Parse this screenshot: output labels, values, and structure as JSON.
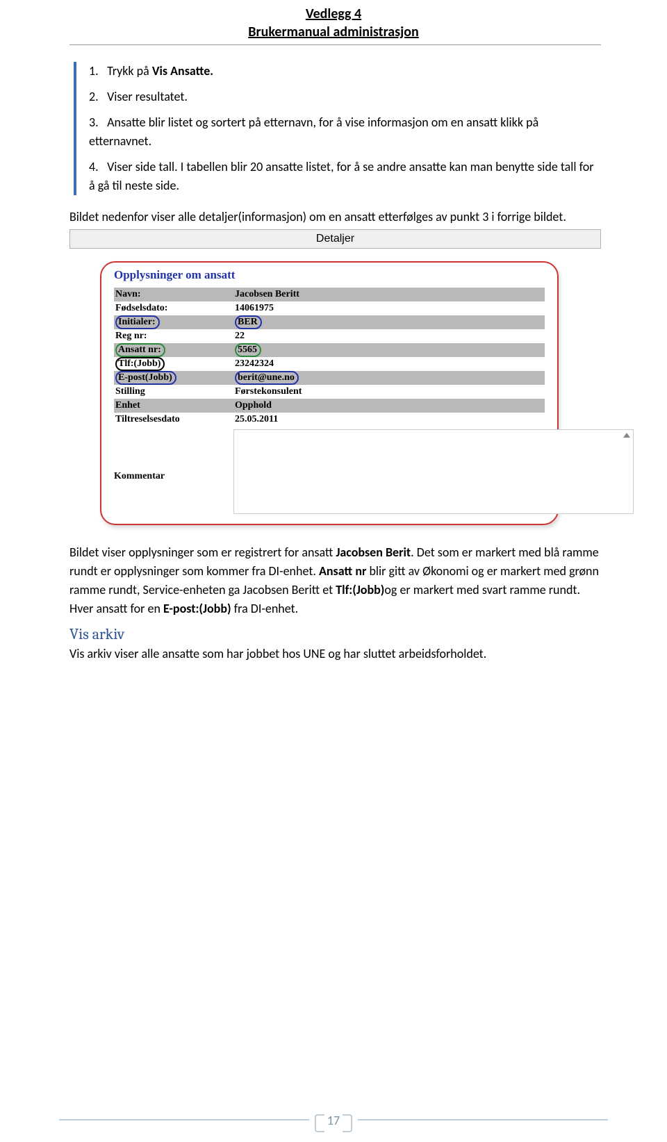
{
  "header": {
    "title": "Vedlegg 4",
    "subtitle": "Brukermanual administrasjon"
  },
  "steps": {
    "s1_pre": "Trykk på ",
    "s1_bold": "Vis Ansatte.",
    "s2": "Viser resultatet.",
    "s3": "Ansatte blir listet og sortert på etternavn, for å vise informasjon om en ansatt klikk på etternavnet.",
    "s4": "Viser side tall. I tabellen blir 20 ansatte listet, for å se andre ansatte kan man benytte side tall for å gå til neste side."
  },
  "intro_para": "Bildet nedenfor viser alle detaljer(informasjon) om en ansatt etterfølges av punkt 3 i forrige bildet.",
  "detaljer_label": "Detaljer",
  "panel": {
    "heading": "Opplysninger om ansatt",
    "rows": [
      {
        "label": "Navn:",
        "value": "Jacobsen Beritt"
      },
      {
        "label": "Fødselsdato:",
        "value": "14061975"
      },
      {
        "label": "Initialer:",
        "value": "BER"
      },
      {
        "label": "Reg nr:",
        "value": "22"
      },
      {
        "label": "Ansatt nr:",
        "value": "5565"
      },
      {
        "label": "Tlf:(Jobb)",
        "value": "23242324"
      },
      {
        "label": "E-post(Jobb)",
        "value": "berit@une.no"
      },
      {
        "label": "Stilling",
        "value": "Førstekonsulent"
      },
      {
        "label": "Enhet",
        "value": "Opphold"
      },
      {
        "label": "Tiltreselsesdato",
        "value": "25.05.2011"
      }
    ],
    "kommentar": "Kommentar"
  },
  "body2": {
    "p1_a": "Bildet viser opplysninger som er registrert for ansatt ",
    "p1_bold1": "Jacobsen Berit",
    "p1_b": ". Det som er markert med blå ramme rundt er opplysninger som kommer fra DI-enhet. ",
    "p1_bold2": "Ansatt nr",
    "p1_c": " blir gitt av Økonomi og er markert med grønn ramme rundt, Service-enheten ga Jacobsen Beritt et ",
    "p1_bold3": "Tlf:(Jobb)",
    "p1_d": "og er markert med svart ramme rundt. Hver ansatt for en ",
    "p1_bold4": "E-post:(Jobb)",
    "p1_e": " fra DI-enhet."
  },
  "vis_arkiv": {
    "heading": "Vis arkiv",
    "text": "Vis arkiv viser alle ansatte som har jobbet hos UNE og har sluttet arbeidsforholdet."
  },
  "footer": {
    "page": "17"
  }
}
